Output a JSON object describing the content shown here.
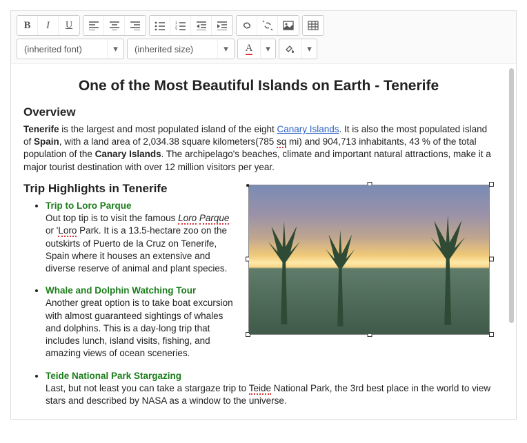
{
  "toolbar": {
    "font_family_display": "(inherited font)",
    "font_size_display": "(inherited size)"
  },
  "doc": {
    "title": "One of the Most Beautiful Islands on Earth - Tenerife",
    "overview_heading": "Overview",
    "overview_p1_lead": "Tenerife",
    "overview_p1_a": " is the largest and most populated island of the eight ",
    "overview_link": "Canary Islands",
    "overview_p1_b": ". It is also the most populated island of ",
    "overview_bold_spain": "Spain",
    "overview_p1_c": ", with a land area of 2,034.38 square kilometers(785 ",
    "overview_sq": "sq",
    "overview_p1_d": " mi) and 904,713 inhabitants, 43 % of the total population of the ",
    "overview_bold_canary": "Canary Islands",
    "overview_p1_e": ". The archipelago's beaches, climate and important natural attractions, make it a major tourist destination with over 12 million visitors per year.",
    "highlights_heading": "Trip Highlights in Tenerife",
    "items": [
      {
        "title": "Trip to Loro Parque",
        "pre": "Out top tip is to visit the famous ",
        "em1": "Loro",
        "em2": "Parque",
        "mid": " or '",
        "em3": "Loro",
        "post": " Park. It is a 13.5-hectare zoo on the outskirts of Puerto de la Cruz on Tenerife, Spain where it houses an extensive and diverse reserve of animal and plant species."
      },
      {
        "title": "Whale and Dolphin Watching Tour",
        "body": "Another great option is to take boat excursion with almost guaranteed sightings of whales and dolphins. This is a day-long trip that includes lunch, island visits, fishing, and amazing views of ocean sceneries."
      },
      {
        "title": "Teide National Park Stargazing",
        "pre": "Last, but not least you can take a stargaze trip to ",
        "em1": "Teide",
        "post": " National Park, the 3rd best place in the world to view stars and described by NASA as a window to the universe."
      }
    ]
  }
}
